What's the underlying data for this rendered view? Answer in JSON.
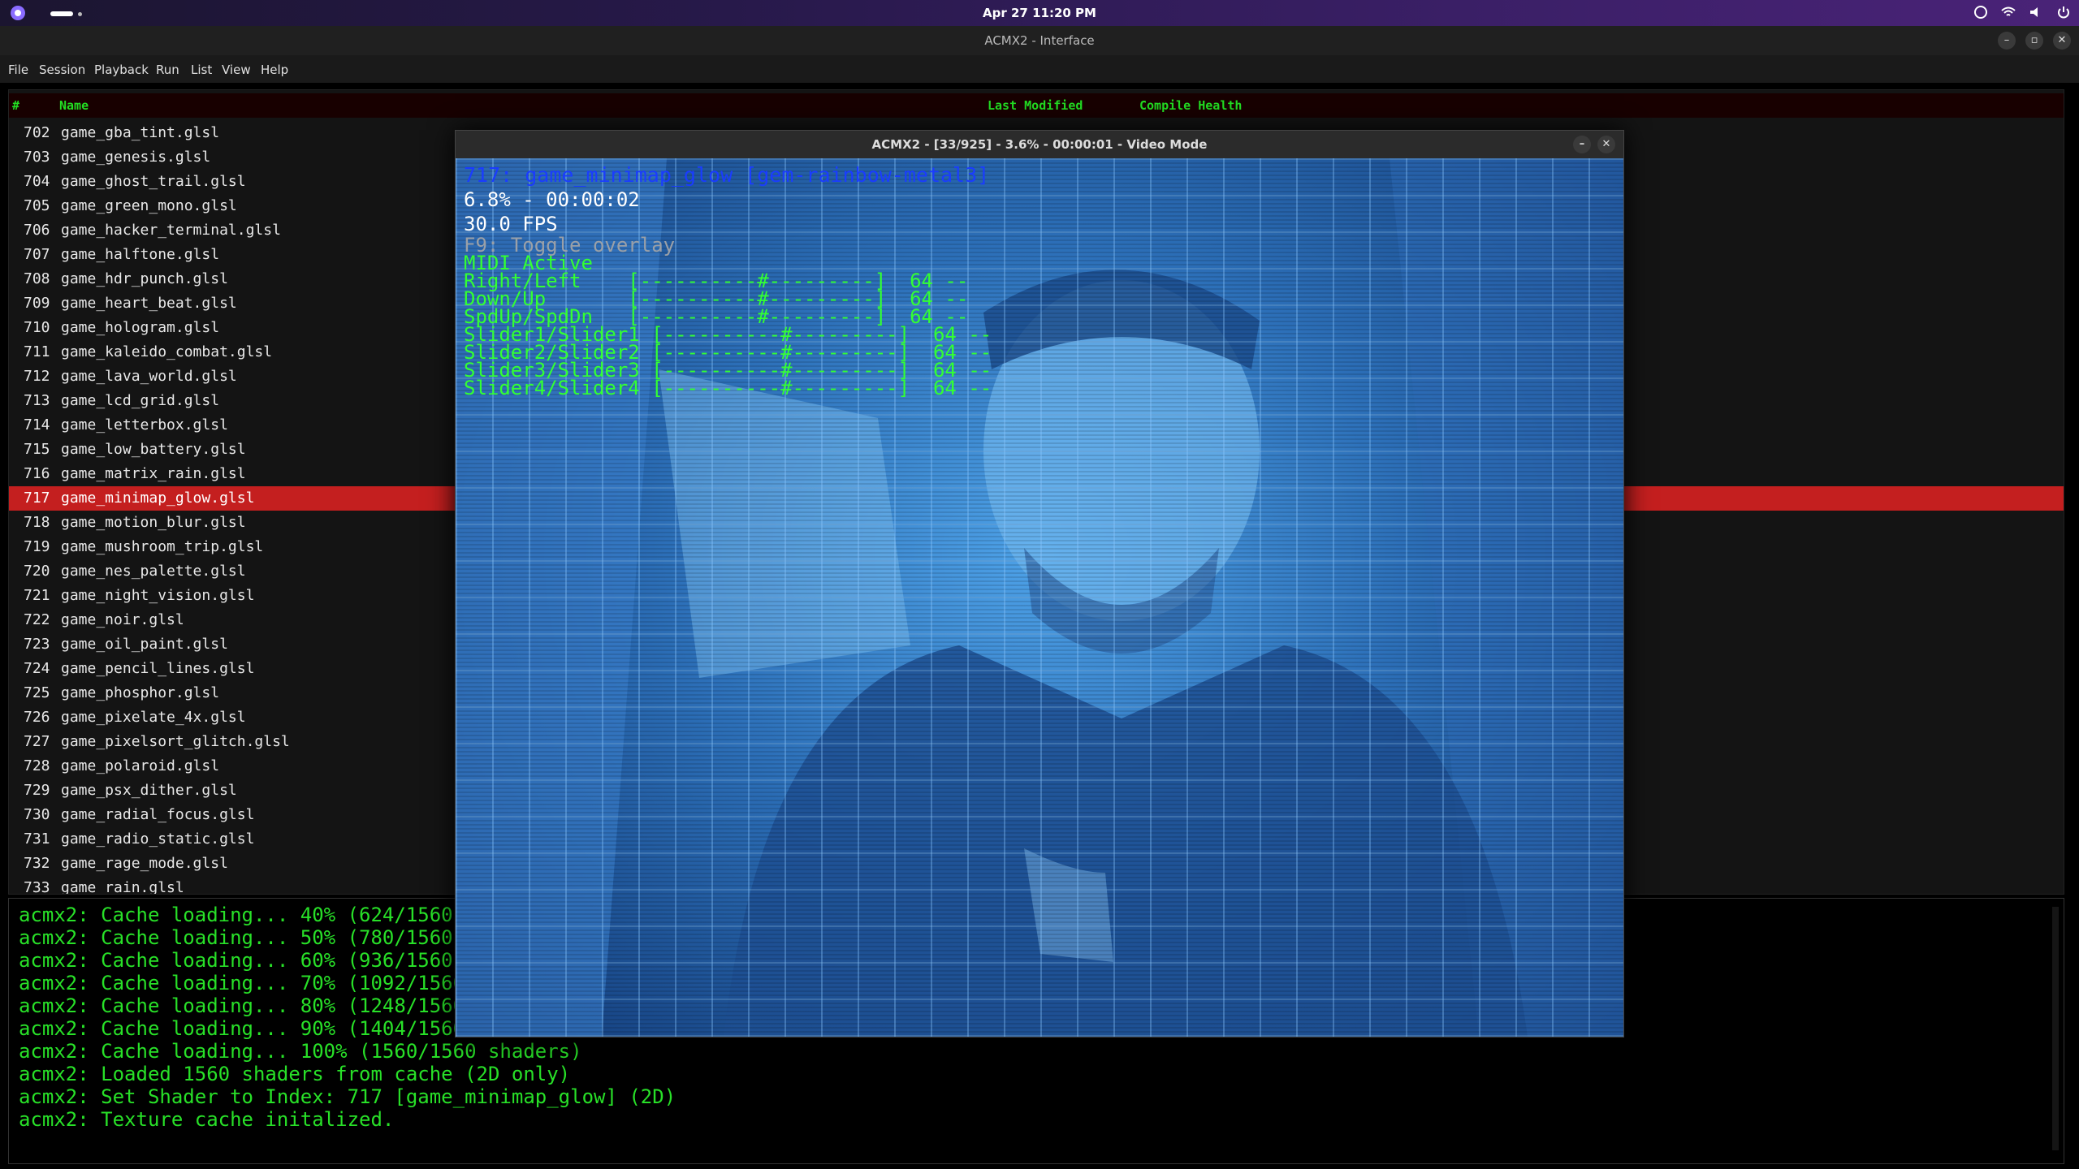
{
  "topbar": {
    "clock": "Apr 27  11:20 PM"
  },
  "window": {
    "title": "ACMX2 - Interface"
  },
  "menu": [
    "File",
    "Session",
    "Playback",
    "Run",
    "List",
    "View",
    "Help"
  ],
  "list": {
    "headers": {
      "num": "#",
      "name": "Name",
      "modified": "Last Modified",
      "health": "Compile Health"
    },
    "selected_index": 15,
    "rows": [
      {
        "num": "702",
        "name": "game_gba_tint.glsl"
      },
      {
        "num": "703",
        "name": "game_genesis.glsl"
      },
      {
        "num": "704",
        "name": "game_ghost_trail.glsl"
      },
      {
        "num": "705",
        "name": "game_green_mono.glsl"
      },
      {
        "num": "706",
        "name": "game_hacker_terminal.glsl"
      },
      {
        "num": "707",
        "name": "game_halftone.glsl"
      },
      {
        "num": "708",
        "name": "game_hdr_punch.glsl"
      },
      {
        "num": "709",
        "name": "game_heart_beat.glsl"
      },
      {
        "num": "710",
        "name": "game_hologram.glsl"
      },
      {
        "num": "711",
        "name": "game_kaleido_combat.glsl"
      },
      {
        "num": "712",
        "name": "game_lava_world.glsl"
      },
      {
        "num": "713",
        "name": "game_lcd_grid.glsl"
      },
      {
        "num": "714",
        "name": "game_letterbox.glsl"
      },
      {
        "num": "715",
        "name": "game_low_battery.glsl"
      },
      {
        "num": "716",
        "name": "game_matrix_rain.glsl"
      },
      {
        "num": "717",
        "name": "game_minimap_glow.glsl"
      },
      {
        "num": "718",
        "name": "game_motion_blur.glsl"
      },
      {
        "num": "719",
        "name": "game_mushroom_trip.glsl"
      },
      {
        "num": "720",
        "name": "game_nes_palette.glsl"
      },
      {
        "num": "721",
        "name": "game_night_vision.glsl"
      },
      {
        "num": "722",
        "name": "game_noir.glsl"
      },
      {
        "num": "723",
        "name": "game_oil_paint.glsl"
      },
      {
        "num": "724",
        "name": "game_pencil_lines.glsl"
      },
      {
        "num": "725",
        "name": "game_phosphor.glsl"
      },
      {
        "num": "726",
        "name": "game_pixelate_4x.glsl"
      },
      {
        "num": "727",
        "name": "game_pixelsort_glitch.glsl"
      },
      {
        "num": "728",
        "name": "game_polaroid.glsl"
      },
      {
        "num": "729",
        "name": "game_psx_dither.glsl"
      },
      {
        "num": "730",
        "name": "game_radial_focus.glsl"
      },
      {
        "num": "731",
        "name": "game_radio_static.glsl"
      },
      {
        "num": "732",
        "name": "game_rage_mode.glsl"
      },
      {
        "num": "733",
        "name": "game_rain.glsl"
      }
    ]
  },
  "console": {
    "lines": [
      "acmx2: Cache loading... 40% (624/1560",
      "acmx2: Cache loading... 50% (780/1560",
      "acmx2: Cache loading... 60% (936/1560",
      "acmx2: Cache loading... 70% (1092/1560",
      "acmx2: Cache loading... 80% (1248/1560",
      "acmx2: Cache loading... 90% (1404/1560",
      "acmx2: Cache loading... 100% (1560/1560 shaders)",
      "acmx2: Loaded 1560 shaders from cache (2D only)",
      "acmx2: Set Shader to Index: 717 [game_minimap_glow] (2D)",
      "acmx2: Texture cache initalized."
    ]
  },
  "video": {
    "title": "ACMX2 - [33/925] - 3.6% - 00:00:01 - Video Mode",
    "overlay": {
      "title": "717: game_minimap_glow [gem-rainbow-metal3]",
      "progress": "6.8% - 00:00:02",
      "fps": "30.0 FPS",
      "hint": "F9: Toggle overlay",
      "midi": "MIDI Active",
      "controls": [
        "Right/Left    [----------#---------]  64 --",
        "Down/Up       [----------#---------]  64 --",
        "SpdUp/SpdDn   [----------#---------]  64 --",
        "Slider1/Slider1 [----------#---------]  64 --",
        "Slider2/Slider2 [----------#---------]  64 --",
        "Slider3/Slider3 [----------#---------]  64 --",
        "Slider4/Slider4 [----------#---------]  64 --"
      ]
    }
  }
}
